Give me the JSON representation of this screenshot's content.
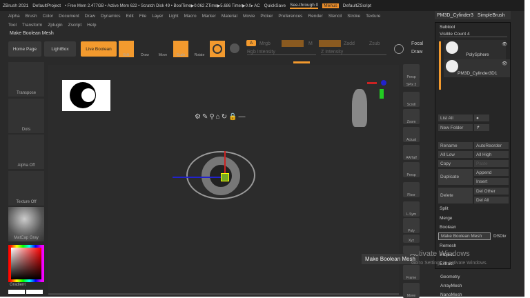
{
  "titlebar": {
    "app": "ZBrush 2021",
    "project": "DefaultProject",
    "status": "• Free Mem 2.477GB • Active Mem 622 • Scratch Disk 49 • BoolTime▶0.062 ZTime▶5.686 Timer▶0.0▸ AC",
    "quicksave": "QuickSave",
    "seethrough": "See-through  0",
    "menus": "Menus",
    "zscript": "DefaultZScript"
  },
  "menus": {
    "row1": [
      "Alpha",
      "Brush",
      "Color",
      "Document",
      "Draw",
      "Dynamics",
      "Edit",
      "File",
      "Layer",
      "Light",
      "Macro",
      "Marker",
      "Material",
      "Movie",
      "Picker",
      "Preferences",
      "Render",
      "Stencil",
      "Stroke",
      "Texture"
    ],
    "row2": [
      "Tool",
      "Transform",
      "Zplugin",
      "Zscript",
      "Help"
    ]
  },
  "hint": "Make Boolean Mesh",
  "toolbar": {
    "home": "Home Page",
    "lightbox": "LightBox",
    "live_boolean": "Live Boolean",
    "edit": "Edit",
    "draw": "Draw",
    "move": "Move",
    "scale": "Scale",
    "rotate": "Rotate",
    "a_label": "A",
    "mrgb": "Mrgb",
    "m": "M",
    "zadd": "Zadd",
    "zsub": "Zsub",
    "rgb_intensity": "Rgb Intensity",
    "z_intensity": "Z Intensity",
    "focal": "Focal",
    "draw_size": "Draw"
  },
  "left_shelf": [
    "Transpose",
    "Dots",
    "Alpha Off",
    "Texture Off",
    "MatCap Gray",
    "Gradient"
  ],
  "right_shelf": [
    "Persp",
    "SPix 3",
    "Scroll",
    "Zoom",
    "Actual",
    "AAHalf",
    "Persp",
    "Floor",
    "L.Sym",
    "Poly",
    "Xyz",
    "",
    "Frame",
    "Move"
  ],
  "tool_tabs": [
    "PM3D_Cylinder3",
    "SimpleBrush"
  ],
  "subtool": {
    "title": "Subtool",
    "visible_count": "Visible Count 4",
    "items": [
      "PolySphere",
      "PM3D_Cylinder3D1"
    ],
    "buttons": {
      "list_all": "List All",
      "new_folder": "New Folder",
      "rename": "Rename",
      "autoreorder": "AutoReorder",
      "all_low": "All Low",
      "all_high": "All High",
      "copy": "Copy",
      "paste": "Paste",
      "duplicate": "Duplicate",
      "append": "Append",
      "insert": "Insert",
      "delete": "Delete",
      "del_other": "Del Other",
      "del_all": "Del All",
      "split": "Split",
      "merge": "Merge",
      "boolean": "Boolean",
      "make_boolean": "Make Boolean Mesh",
      "dsdiv": "DSDiv",
      "remesh": "Remesh",
      "project": "Project",
      "extract": "Extract",
      "geometry": "Geometry",
      "arraymesh": "ArrayMesh",
      "nanomesh": "NanoMesh"
    }
  },
  "tooltip": "Make Boolean Mesh",
  "watermark": {
    "title": "Activate Windows",
    "sub": "Go to Settings to activate Windows."
  },
  "colors": {
    "accent": "#f39a2e",
    "bg": "#2a2a2a"
  }
}
